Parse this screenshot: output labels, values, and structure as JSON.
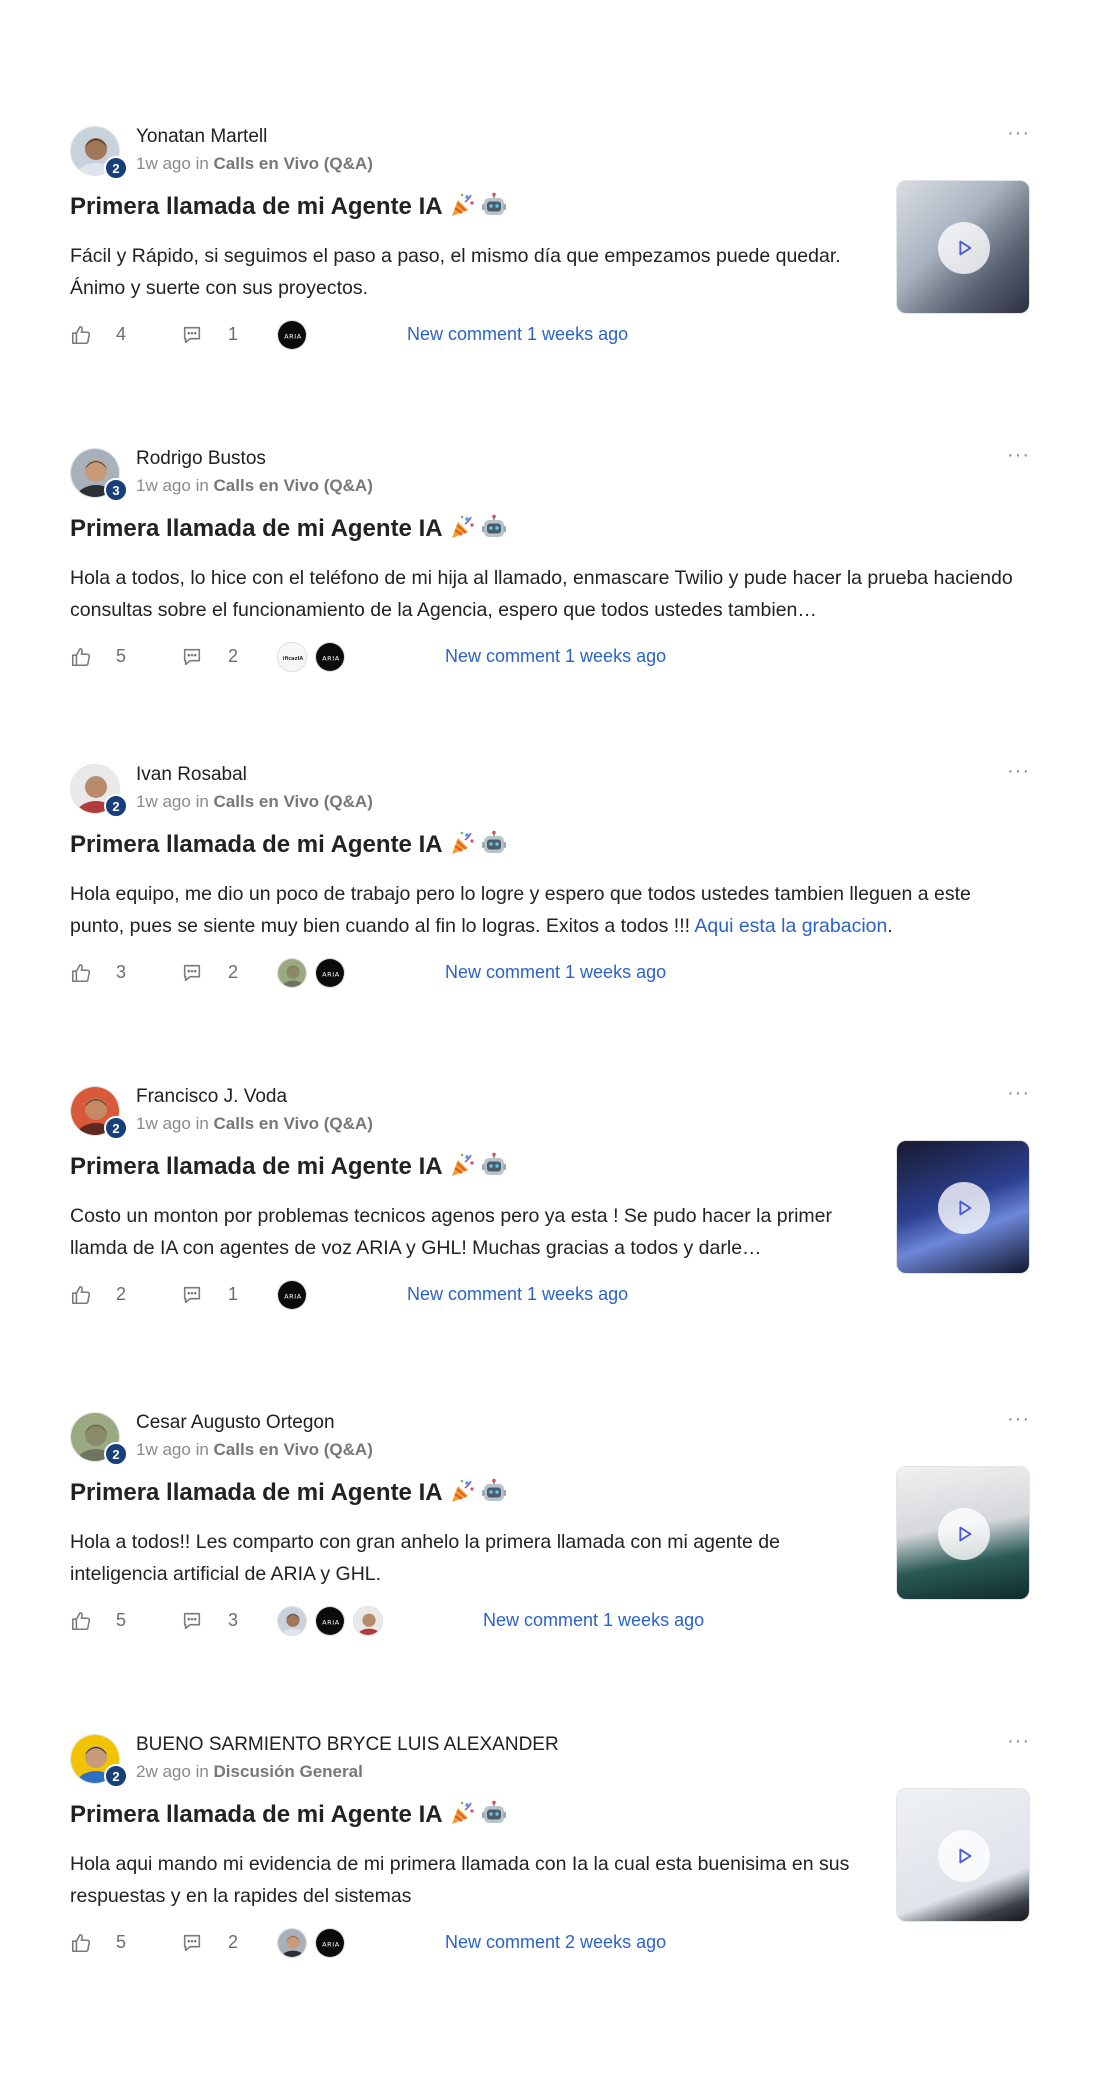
{
  "feed": {
    "posts": [
      {
        "author": "Yonatan Martell",
        "level": "2",
        "time": "1w ago",
        "in_word": "in",
        "category": "Calls en Vivo (Q&A)",
        "title": "Primera llamada de mi Agente IA",
        "title_emojis": [
          "party-popper-icon",
          "robot-face-icon"
        ],
        "body": "Fácil y Rápido, si seguimos el paso a paso, el mismo día que empezamos puede quedar. Ánimo y suerte con sus proyectos.",
        "link_text": "",
        "body_tail": "",
        "likes": "4",
        "comments": "1",
        "commenter_avatars": [
          "aria-logo-avatar"
        ],
        "new_comment": "New comment 1 weeks ago",
        "more_label": "···",
        "has_video_thumbnail": true
      },
      {
        "author": "Rodrigo Bustos",
        "level": "3",
        "time": "1w ago",
        "in_word": "in",
        "category": "Calls en Vivo (Q&A)",
        "title": "Primera llamada de mi Agente IA",
        "title_emojis": [
          "party-popper-icon",
          "robot-face-icon"
        ],
        "body": "Hola a todos, lo hice con el teléfono de mi hija al llamado, enmascare Twilio y pude hacer la prueba haciendo consultas sobre el funcionamiento de la Agencia, espero que todos ustedes tambien…",
        "link_text": "",
        "body_tail": "",
        "likes": "5",
        "comments": "2",
        "commenter_avatars": [
          "eficaz-logo-avatar",
          "aria-logo-avatar"
        ],
        "commenter_texts": [
          "ificazIA",
          "ARIA"
        ],
        "new_comment": "New comment 1 weeks ago",
        "more_label": "···",
        "has_video_thumbnail": false
      },
      {
        "author": "Ivan Rosabal",
        "level": "2",
        "time": "1w ago",
        "in_word": "in",
        "category": "Calls en Vivo (Q&A)",
        "title": "Primera llamada de mi Agente IA",
        "title_emojis": [
          "party-popper-icon",
          "robot-face-icon"
        ],
        "body": "Hola equipo, me dio un poco de trabajo pero lo logre y espero que todos ustedes tambien lleguen a este punto, pues se siente muy bien cuando al fin lo logras. Exitos a todos !!! ",
        "link_text": "Aqui esta la grabacion",
        "body_tail": ".",
        "likes": "3",
        "comments": "2",
        "commenter_avatars": [
          "user-photo-avatar",
          "aria-logo-avatar"
        ],
        "new_comment": "New comment 1 weeks ago",
        "more_label": "···",
        "has_video_thumbnail": false
      },
      {
        "author": "Francisco J. Voda",
        "level": "2",
        "time": "1w ago",
        "in_word": "in",
        "category": "Calls en Vivo (Q&A)",
        "title": "Primera llamada de mi Agente IA",
        "title_emojis": [
          "party-popper-icon",
          "robot-face-icon"
        ],
        "body": "Costo un monton por problemas tecnicos agenos pero ya esta ! Se pudo hacer la primer llamda de IA con agentes de voz ARIA y GHL! Muchas gracias a todos y darle…",
        "link_text": "",
        "body_tail": "",
        "likes": "2",
        "comments": "1",
        "commenter_avatars": [
          "aria-logo-avatar"
        ],
        "new_comment": "New comment 1 weeks ago",
        "more_label": "···",
        "has_video_thumbnail": true
      },
      {
        "author": "Cesar Augusto Ortegon",
        "level": "2",
        "time": "1w ago",
        "in_word": "in",
        "category": "Calls en Vivo (Q&A)",
        "title": "Primera llamada de mi Agente IA",
        "title_emojis": [
          "party-popper-icon",
          "robot-face-icon"
        ],
        "body": "Hola a todos!! Les comparto con gran anhelo la primera llamada con mi agente de inteligencia artificial de ARIA y GHL.",
        "link_text": "",
        "body_tail": "",
        "likes": "5",
        "comments": "3",
        "commenter_avatars": [
          "user-photo-avatar",
          "aria-logo-avatar",
          "user-photo-avatar"
        ],
        "new_comment": "New comment 1 weeks ago",
        "more_label": "···",
        "has_video_thumbnail": true
      },
      {
        "author": "BUENO SARMIENTO BRYCE LUIS ALEXANDER",
        "level": "2",
        "time": "2w ago",
        "in_word": "in",
        "category": "Discusión General",
        "title": "Primera llamada de mi Agente IA",
        "title_emojis": [
          "party-popper-icon",
          "robot-face-icon"
        ],
        "body": "Hola aqui mando mi evidencia de mi primera llamada con Ia la cual esta buenisima en sus respuestas y en la rapides del sistemas",
        "link_text": "",
        "body_tail": "",
        "likes": "5",
        "comments": "2",
        "commenter_avatars": [
          "user-photo-avatar",
          "aria-logo-avatar"
        ],
        "new_comment": "New comment 2 weeks ago",
        "more_label": "···",
        "has_video_thumbnail": true
      }
    ],
    "colors": {
      "link_blue": "#2b62c8",
      "level_badge": "#173f79",
      "muted_text": "#8a8a8a"
    }
  }
}
